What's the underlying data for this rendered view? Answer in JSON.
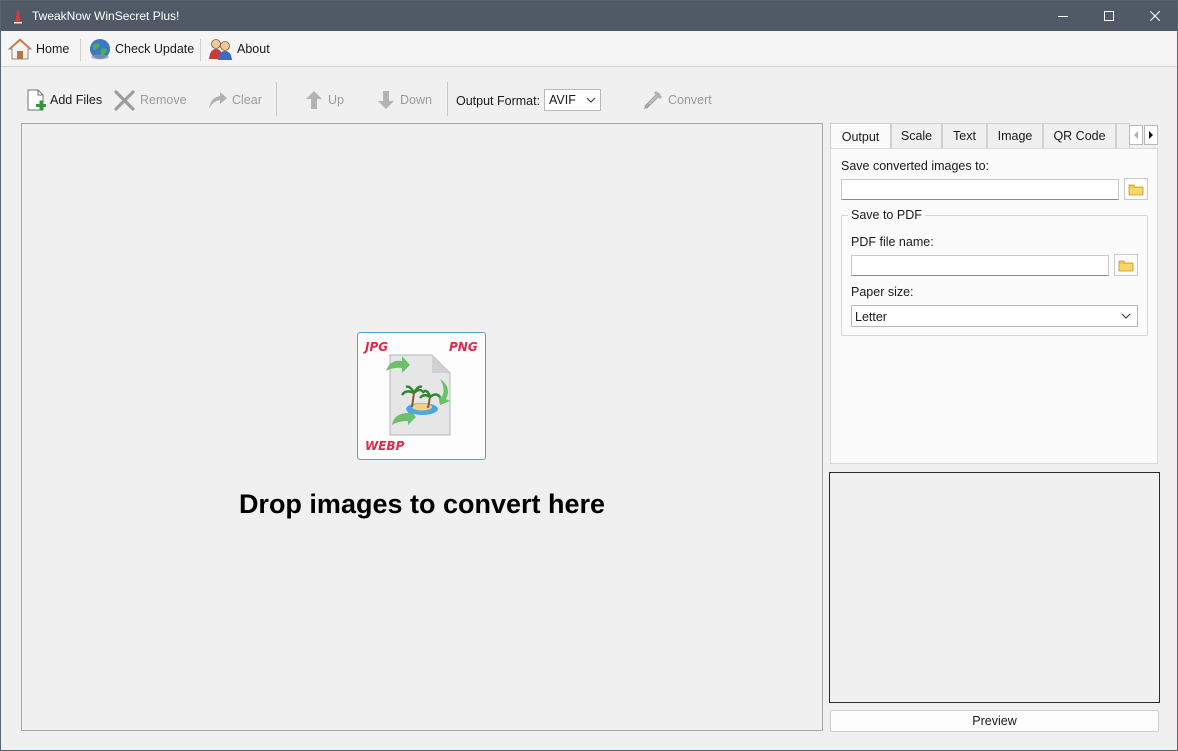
{
  "window": {
    "title": "TweakNow WinSecret Plus!",
    "controls": [
      "minimize",
      "maximize",
      "close"
    ]
  },
  "menubar": {
    "items": [
      {
        "label": "Home",
        "icon": "house-icon"
      },
      {
        "label": "Check Update",
        "icon": "globe-icon"
      },
      {
        "label": "About",
        "icon": "users-icon"
      }
    ]
  },
  "toolbar": {
    "add_files": "Add Files",
    "remove": "Remove",
    "clear": "Clear",
    "up": "Up",
    "down": "Down",
    "output_format_label": "Output Format:",
    "output_format_value": "AVIF",
    "convert": "Convert"
  },
  "dropzone": {
    "message": "Drop images to convert here",
    "labels": {
      "jpg": "JPG",
      "png": "PNG",
      "webp": "WEBP"
    }
  },
  "panel": {
    "tabs": [
      "Output",
      "Scale",
      "Text",
      "Image",
      "QR Code"
    ],
    "active_tab": "Output",
    "save_to_label": "Save converted images to:",
    "save_to_value": "",
    "pdf_group_title": "Save to PDF",
    "pdf_file_label": "PDF file name:",
    "pdf_file_value": "",
    "paper_size_label": "Paper size:",
    "paper_size_value": "Letter"
  },
  "preview": {
    "button_label": "Preview"
  },
  "colors": {
    "titlebar": "#4f5a66",
    "accent_border": "#4aa3df",
    "format_label_red": "#e02a4a"
  }
}
